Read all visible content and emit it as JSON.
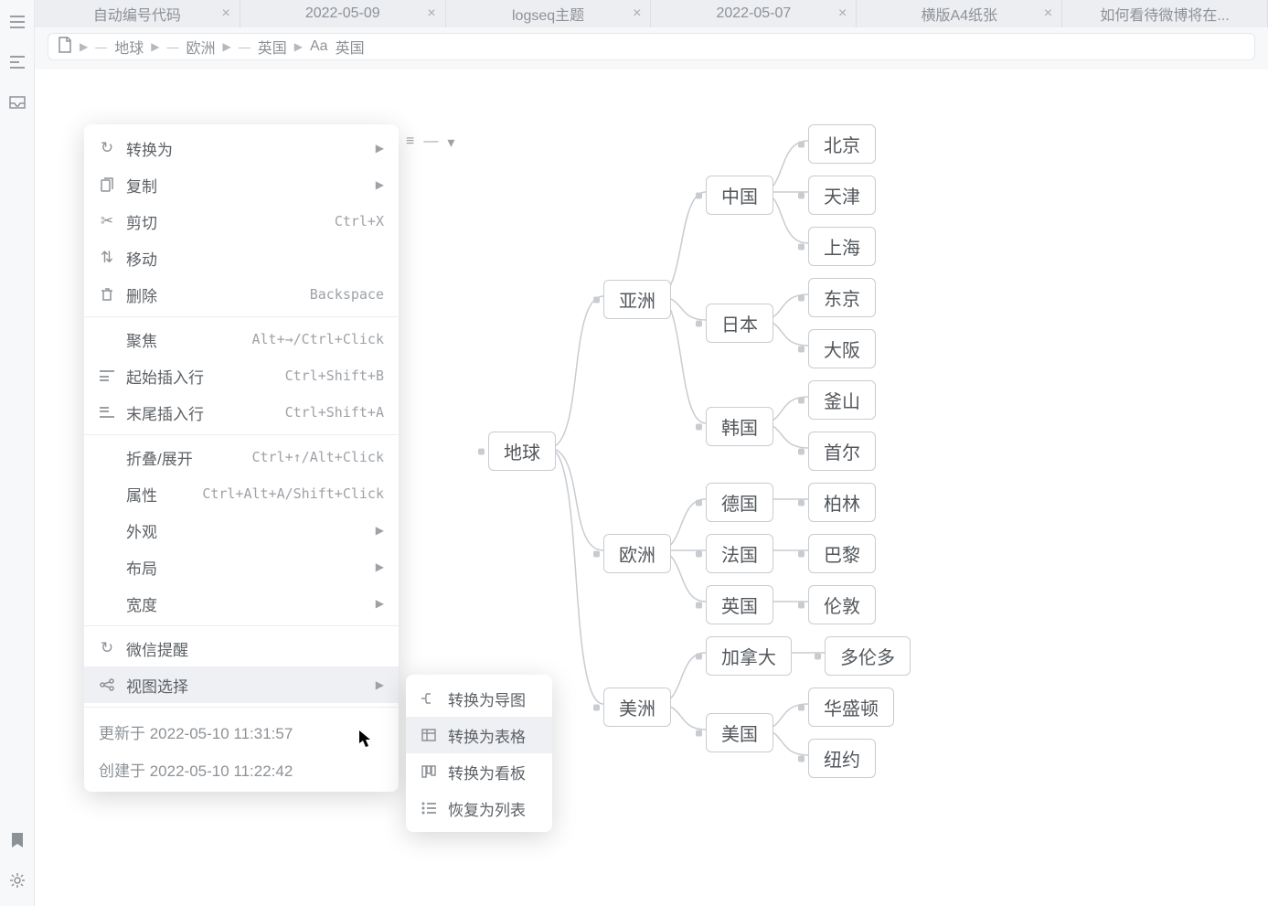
{
  "tabs": [
    {
      "label": "自动编号代码",
      "close": "×"
    },
    {
      "label": "2022-05-09",
      "close": "×"
    },
    {
      "label": "logseq主题",
      "close": "×"
    },
    {
      "label": "2022-05-07",
      "close": "×"
    },
    {
      "label": "横版A4纸张",
      "close": "×"
    },
    {
      "label": "如何看待微博将在...",
      "close": ""
    }
  ],
  "breadcrumb": {
    "seg1": "地球",
    "seg2": "欧洲",
    "seg3": "英国",
    "seg4_prefix": "Aa",
    "seg4": "英国"
  },
  "context_menu": {
    "convert": "转换为",
    "copy": "复制",
    "cut": "剪切",
    "cut_hint": "Ctrl+X",
    "move": "移动",
    "delete": "删除",
    "delete_hint": "Backspace",
    "focus": "聚焦",
    "focus_hint": "Alt+→/Ctrl+Click",
    "insert_before": "起始插入行",
    "insert_before_hint": "Ctrl+Shift+B",
    "insert_after": "末尾插入行",
    "insert_after_hint": "Ctrl+Shift+A",
    "fold": "折叠/展开",
    "fold_hint": "Ctrl+↑/Alt+Click",
    "attrs": "属性",
    "attrs_hint": "Ctrl+Alt+A/Shift+Click",
    "appearance": "外观",
    "layout": "布局",
    "width": "宽度",
    "wechat": "微信提醒",
    "view_select": "视图选择",
    "updated": "更新于 2022-05-10 11:31:57",
    "created": "创建于 2022-05-10 11:22:42"
  },
  "submenu": {
    "to_mindmap": "转换为导图",
    "to_table": "转换为表格",
    "to_kanban": "转换为看板",
    "to_list": "恢复为列表"
  },
  "mindmap": {
    "root": "地球",
    "asia": "亚洲",
    "china": "中国",
    "beijing": "北京",
    "tianjin": "天津",
    "shanghai": "上海",
    "japan": "日本",
    "tokyo": "东京",
    "osaka": "大阪",
    "korea": "韩国",
    "busan": "釜山",
    "seoul": "首尔",
    "europe": "欧洲",
    "germany": "德国",
    "berlin": "柏林",
    "france": "法国",
    "paris": "巴黎",
    "uk": "英国",
    "london": "伦敦",
    "america": "美洲",
    "canada": "加拿大",
    "toronto": "多伦多",
    "usa": "美国",
    "washington": "华盛顿",
    "newyork": "纽约"
  }
}
